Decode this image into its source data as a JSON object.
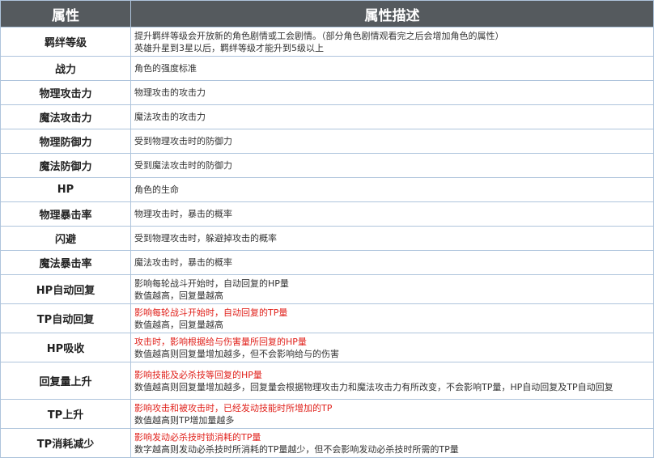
{
  "header": {
    "name_col": "属性",
    "desc_col": "属性描述"
  },
  "rows": [
    {
      "name": "羁绊等级",
      "lines": [
        {
          "text": "提升羁绊等级会开放新的角色剧情或工会剧情。（部分角色剧情观看完之后会增加角色的属性）",
          "color": "#333333"
        },
        {
          "text": "英雄升星到3星以后，羁绊等级才能升到5级以上",
          "color": "#333333"
        }
      ]
    },
    {
      "name": "战力",
      "lines": [
        {
          "text": "角色的强度标准",
          "color": "#333333"
        }
      ]
    },
    {
      "name": "物理攻击力",
      "lines": [
        {
          "text": "物理攻击的攻击力",
          "color": "#333333"
        }
      ]
    },
    {
      "name": "魔法攻击力",
      "lines": [
        {
          "text": "魔法攻击的攻击力",
          "color": "#333333"
        }
      ]
    },
    {
      "name": "物理防御力",
      "lines": [
        {
          "text": "受到物理攻击时的防御力",
          "color": "#333333"
        }
      ]
    },
    {
      "name": "魔法防御力",
      "lines": [
        {
          "text": "受到魔法攻击时的防御力",
          "color": "#333333"
        }
      ]
    },
    {
      "name": "HP",
      "lines": [
        {
          "text": "角色的生命",
          "color": "#333333"
        }
      ]
    },
    {
      "name": "物理暴击率",
      "lines": [
        {
          "text": "物理攻击时，暴击的概率",
          "color": "#333333"
        }
      ]
    },
    {
      "name": "闪避",
      "lines": [
        {
          "text": "受到物理攻击时，躲避掉攻击的概率",
          "color": "#333333"
        }
      ]
    },
    {
      "name": "魔法暴击率",
      "lines": [
        {
          "text": "魔法攻击时，暴击的概率",
          "color": "#333333"
        }
      ]
    },
    {
      "name": "HP自动回复",
      "lines": [
        {
          "text": "影响每轮战斗开始时，自动回复的HP量",
          "color": "#333333"
        },
        {
          "text": "数值越高，回复量越高",
          "color": "#333333"
        }
      ]
    },
    {
      "name": "TP自动回复",
      "lines": [
        {
          "text": "影响每轮战斗开始时，自动回复的TP量",
          "color": "#e0211b"
        },
        {
          "text": "数值越高，回复量越高",
          "color": "#333333"
        }
      ]
    },
    {
      "name": "HP吸收",
      "lines": [
        {
          "text": "攻击时，影响根据给与伤害量所回复的HP量",
          "color": "#e0211b"
        },
        {
          "text": "数值越高则回复量增加越多，但不会影响给与的伤害",
          "color": "#333333"
        }
      ]
    },
    {
      "name": "回复量上升",
      "lines": [
        {
          "text": "影响技能及必杀技等回复的HP量",
          "color": "#e0211b"
        },
        {
          "text": "数值越高则回复量增加越多，回复量会根据物理攻击力和魔法攻击力有所改变，不会影响TP量，HP自动回复及TP自动回复",
          "color": "#333333"
        }
      ]
    },
    {
      "name": "TP上升",
      "lines": [
        {
          "text": "影响攻击和被攻击时，已经发动技能时所增加的TP",
          "color": "#e0211b"
        },
        {
          "text": "数值越高则TP增加量越多",
          "color": "#333333"
        }
      ]
    },
    {
      "name": "TP消耗减少",
      "lines": [
        {
          "text": "影响发动必杀技时锁消耗的TP量",
          "color": "#e0211b"
        },
        {
          "text": "数字越高则发动必杀技时所消耗的TP量越少，但不会影响发动必杀技时所需的TP量",
          "color": "#333333"
        }
      ]
    }
  ]
}
